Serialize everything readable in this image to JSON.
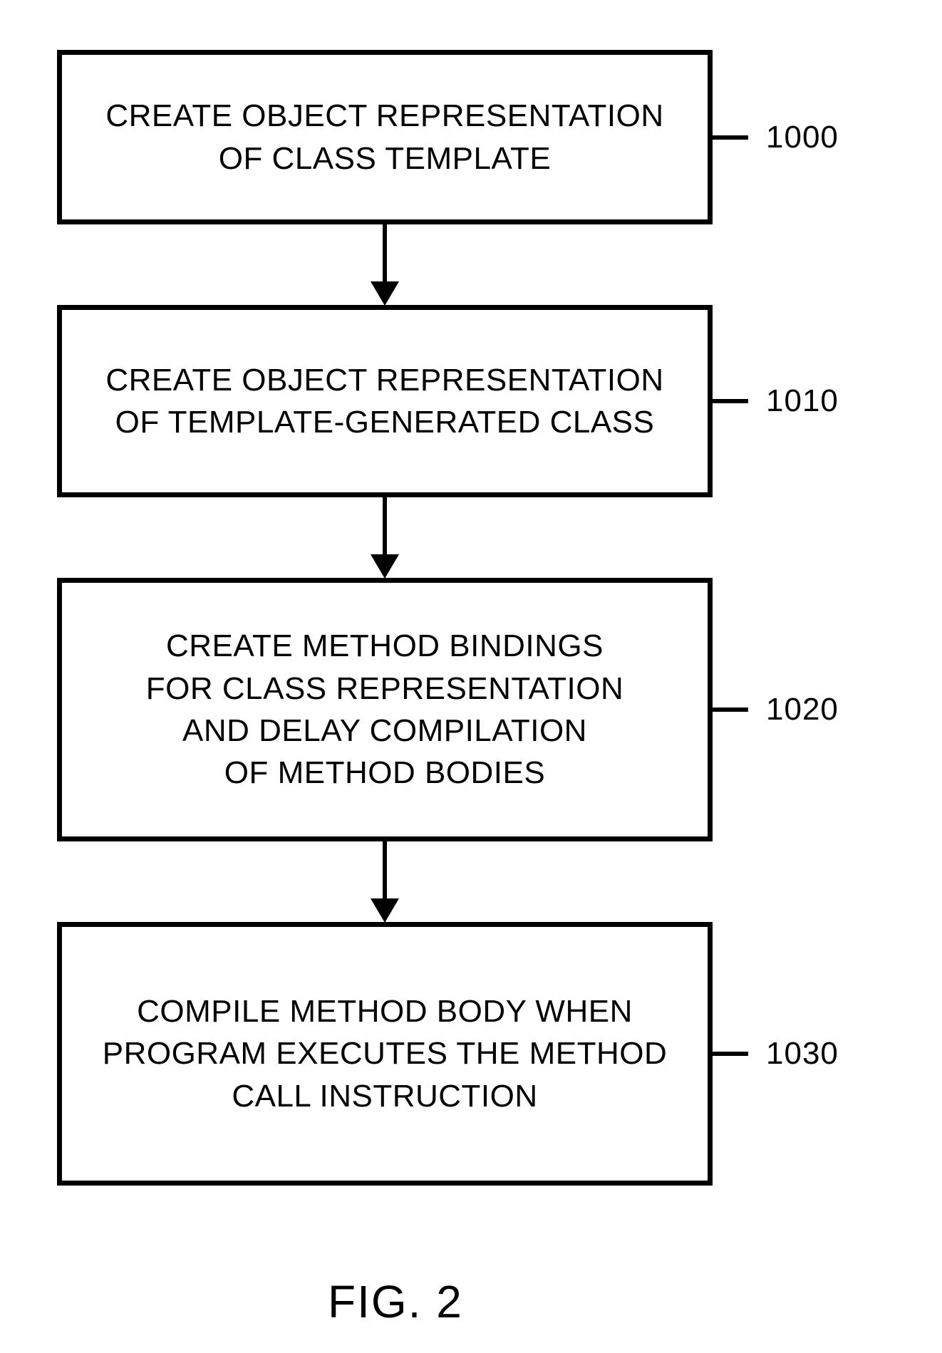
{
  "boxes": {
    "b0": {
      "text": "CREATE OBJECT REPRESENTATION\nOF CLASS TEMPLATE",
      "label": "1000"
    },
    "b1": {
      "text": "CREATE OBJECT REPRESENTATION\nOF TEMPLATE-GENERATED CLASS",
      "label": "1010"
    },
    "b2": {
      "text": "CREATE METHOD BINDINGS\nFOR CLASS REPRESENTATION\nAND DELAY COMPILATION\nOF METHOD BODIES",
      "label": "1020"
    },
    "b3": {
      "text": "COMPILE METHOD BODY WHEN\nPROGRAM EXECUTES THE METHOD\nCALL INSTRUCTION",
      "label": "1030"
    }
  },
  "caption": "FIG. 2"
}
